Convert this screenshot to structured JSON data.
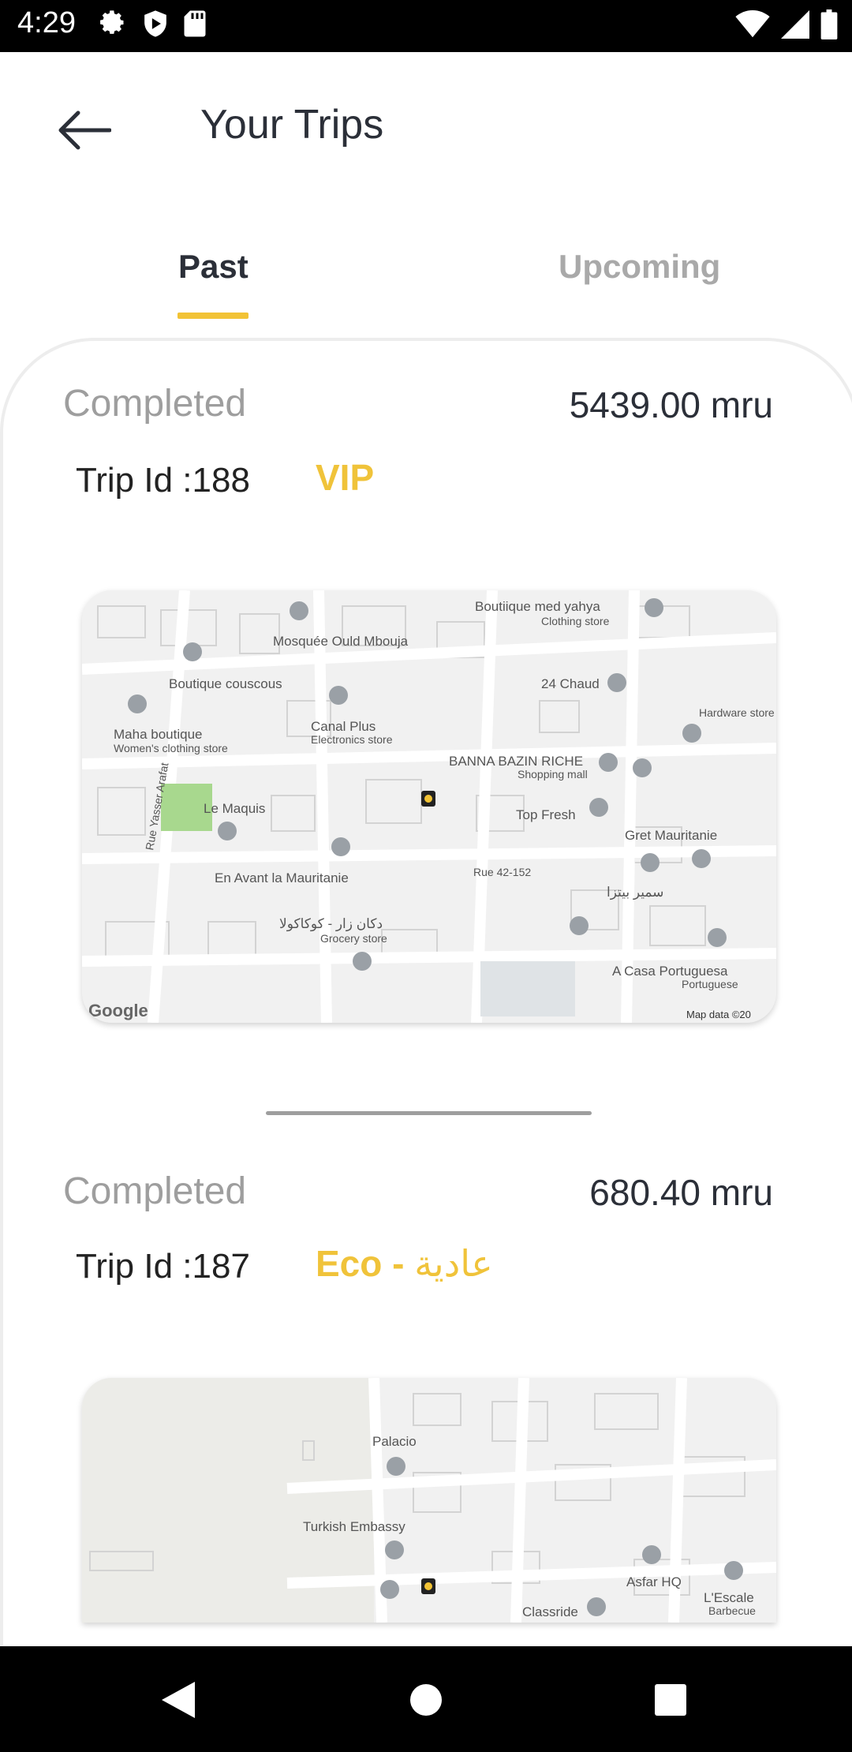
{
  "status_bar": {
    "time": "4:29",
    "left_icons": [
      "settings-icon",
      "shield-icon",
      "sd-card-icon"
    ],
    "right_icons": [
      "wifi-icon",
      "signal-icon",
      "battery-icon"
    ]
  },
  "header": {
    "back_icon": "arrow-left-icon",
    "title": "Your Trips"
  },
  "tabs": [
    {
      "label": "Past",
      "active": true
    },
    {
      "label": "Upcoming",
      "active": false
    }
  ],
  "colors": {
    "accent": "#f2c335",
    "title_text": "#2b2f38",
    "muted_text": "#9e9e9e"
  },
  "trips": [
    {
      "status": "Completed",
      "price": "5439.00 mru",
      "trip_id": "Trip Id :188",
      "type": "VIP",
      "type_ar": "",
      "map_labels": [
        "Boutiique med yahya",
        "Clothing store",
        "Mosquée Ould Mbouja",
        "Boutique couscous",
        "24 Chaud",
        "Hardware store",
        "Maha boutique",
        "Women's clothing store",
        "Canal Plus",
        "Electronics store",
        "BANNA BAZIN RICHE",
        "Shopping mall",
        "Rue Yasser Arafat",
        "Le Maquis",
        "Top Fresh",
        "Gret Mauritanie",
        "En Avant la Mauritanie",
        "Rue 42-152",
        "سمير بيتزا",
        "دكان زار - كوكاكولا",
        "Grocery store",
        "A Casa Portuguesa",
        "Portuguese",
        "Google",
        "Map data ©20"
      ]
    },
    {
      "status": "Completed",
      "price": "680.40 mru",
      "trip_id": "Trip Id :187",
      "type": "Eco - ",
      "type_ar": "عادية",
      "map_labels": [
        "Palacio",
        "Turkish Embassy",
        "Asfar HQ",
        "L'Escale",
        "Barbecue",
        "Classride"
      ]
    }
  ],
  "nav_bar": {
    "icons": [
      "back-triangle-icon",
      "home-circle-icon",
      "recents-square-icon"
    ]
  }
}
